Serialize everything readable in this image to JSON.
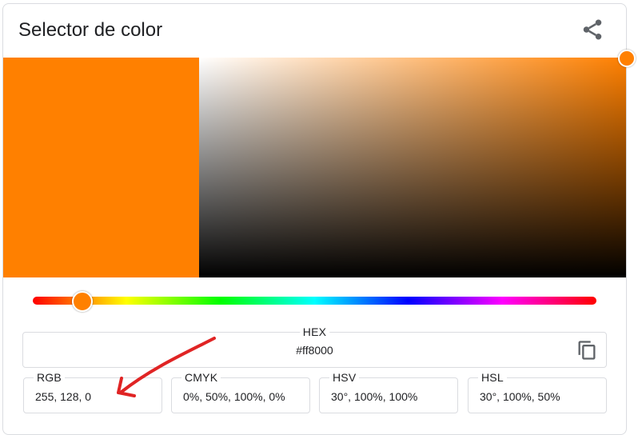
{
  "title": "Selector de color",
  "colors": {
    "selected": "#ff8000",
    "hue": "#ff8000",
    "arrow": "#e02424"
  },
  "icons": {
    "share": "share-icon",
    "copy": "copy-icon"
  },
  "hue_slider_value_degrees": 30,
  "hex": {
    "label": "HEX",
    "value": "#ff8000"
  },
  "rgb": {
    "label": "RGB",
    "value": "255, 128, 0"
  },
  "cmyk": {
    "label": "CMYK",
    "value": "0%, 50%, 100%, 0%"
  },
  "hsv": {
    "label": "HSV",
    "value": "30°, 100%, 100%"
  },
  "hsl": {
    "label": "HSL",
    "value": "30°, 100%, 50%"
  }
}
